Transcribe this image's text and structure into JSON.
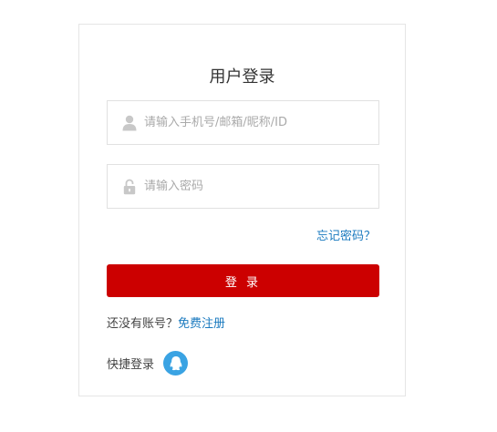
{
  "login": {
    "title": "用户登录",
    "username_placeholder": "请输入手机号/邮箱/昵称/ID",
    "password_placeholder": "请输入密码",
    "forgot_label": "忘记密码？",
    "submit_label": "登 录",
    "no_account_text": "还没有账号？",
    "register_label": "免费注册",
    "quick_login_label": "快捷登录"
  },
  "colors": {
    "primary_button": "#cc0000",
    "link": "#1a7abf",
    "qq_badge": "#3aa3e3"
  },
  "icons": {
    "username": "user-icon",
    "password": "lock-icon",
    "quick_login": "qq-icon"
  }
}
